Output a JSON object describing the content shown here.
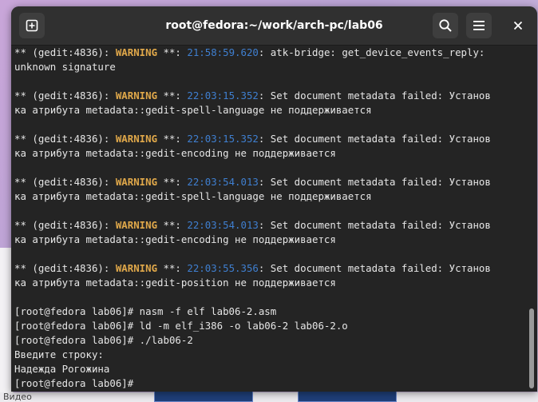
{
  "window": {
    "title": "root@fedora:~/work/arch-pc/lab06",
    "icons": {
      "new_tab": "new-tab-icon",
      "search": "search-icon",
      "menu": "hamburger-menu-icon",
      "close": "close-icon"
    }
  },
  "colors": {
    "terminal_bg": "#242424",
    "warning": "#e0a84a",
    "timestamp": "#3f7fd0",
    "text": "#e6e6e6"
  },
  "background": {
    "taskbar_label": "Видео"
  },
  "terminal": {
    "lines": [
      {
        "pre": "** (gedit:4836): ",
        "warn": "WARNING",
        "mid": " **: ",
        "ts": "21:58:59.620",
        "post": ": atk-bridge: get_device_events_reply:"
      },
      {
        "text": "unknown signature"
      },
      {
        "text": ""
      },
      {
        "pre": "** (gedit:4836): ",
        "warn": "WARNING",
        "mid": " **: ",
        "ts": "22:03:15.352",
        "post": ": Set document metadata failed: Установ"
      },
      {
        "text": "ка атрибута metadata::gedit-spell-language не поддерживается"
      },
      {
        "text": ""
      },
      {
        "pre": "** (gedit:4836): ",
        "warn": "WARNING",
        "mid": " **: ",
        "ts": "22:03:15.352",
        "post": ": Set document metadata failed: Установ"
      },
      {
        "text": "ка атрибута metadata::gedit-encoding не поддерживается"
      },
      {
        "text": ""
      },
      {
        "pre": "** (gedit:4836): ",
        "warn": "WARNING",
        "mid": " **: ",
        "ts": "22:03:54.013",
        "post": ": Set document metadata failed: Установ"
      },
      {
        "text": "ка атрибута metadata::gedit-spell-language не поддерживается"
      },
      {
        "text": ""
      },
      {
        "pre": "** (gedit:4836): ",
        "warn": "WARNING",
        "mid": " **: ",
        "ts": "22:03:54.013",
        "post": ": Set document metadata failed: Установ"
      },
      {
        "text": "ка атрибута metadata::gedit-encoding не поддерживается"
      },
      {
        "text": ""
      },
      {
        "pre": "** (gedit:4836): ",
        "warn": "WARNING",
        "mid": " **: ",
        "ts": "22:03:55.356",
        "post": ": Set document metadata failed: Установ"
      },
      {
        "text": "ка атрибута metadata::gedit-position не поддерживается"
      },
      {
        "text": ""
      },
      {
        "text": "[root@fedora lab06]# nasm -f elf lab06-2.asm"
      },
      {
        "text": "[root@fedora lab06]# ld -m elf_i386 -o lab06-2 lab06-2.o"
      },
      {
        "text": "[root@fedora lab06]# ./lab06-2"
      },
      {
        "text": "Введите строку:"
      },
      {
        "text": "Надежда Рогожина"
      },
      {
        "text": "[root@fedora lab06]# "
      }
    ]
  }
}
